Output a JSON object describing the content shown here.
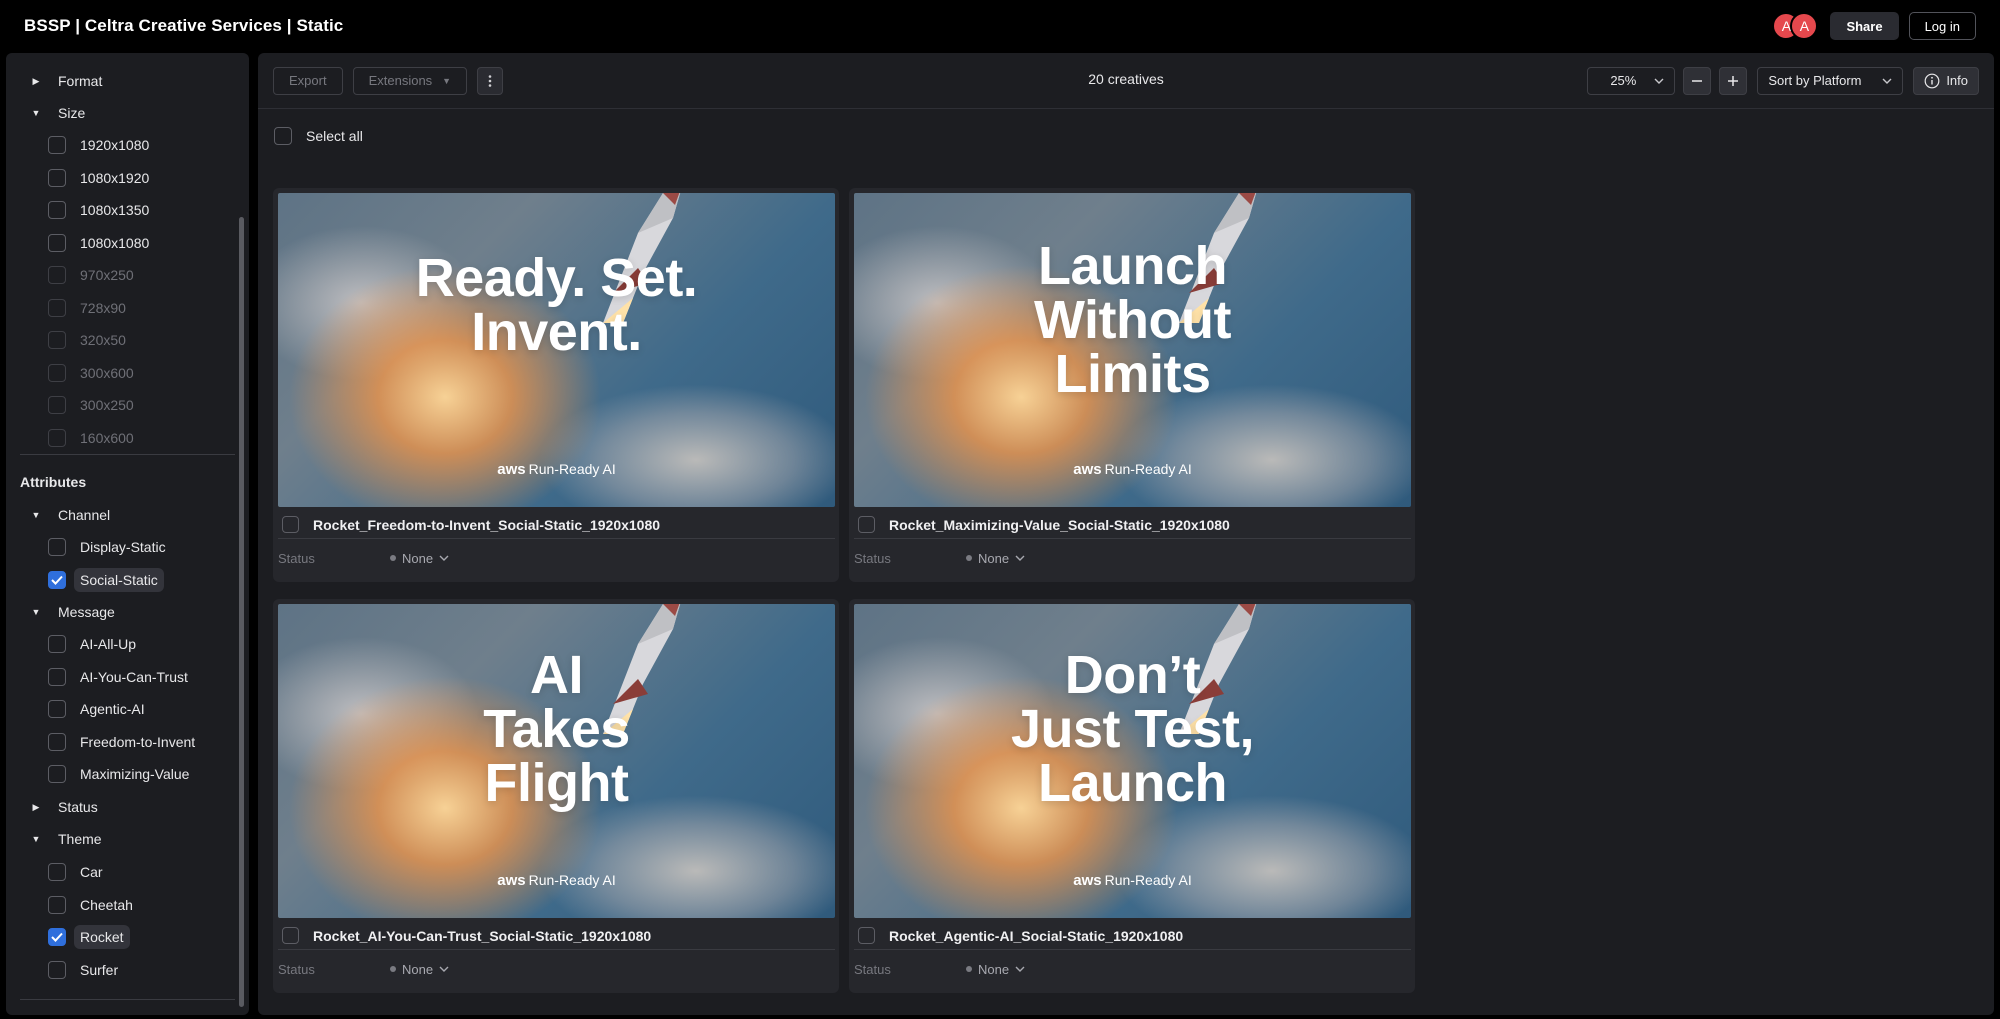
{
  "app_title": "BSSP | Celtra Creative Services | Static",
  "header": {
    "avatars": [
      "A",
      "A"
    ],
    "share_label": "Share",
    "login_label": "Log in",
    "avatar_color": "#e5484d"
  },
  "sidebar": {
    "format_label": "Format",
    "size_label": "Size",
    "sizes": [
      {
        "label": "1920x1080",
        "checked": false,
        "disabled": false
      },
      {
        "label": "1080x1920",
        "checked": false,
        "disabled": false
      },
      {
        "label": "1080x1350",
        "checked": false,
        "disabled": false
      },
      {
        "label": "1080x1080",
        "checked": false,
        "disabled": false
      },
      {
        "label": "970x250",
        "checked": false,
        "disabled": true
      },
      {
        "label": "728x90",
        "checked": false,
        "disabled": true
      },
      {
        "label": "320x50",
        "checked": false,
        "disabled": true
      },
      {
        "label": "300x600",
        "checked": false,
        "disabled": true
      },
      {
        "label": "300x250",
        "checked": false,
        "disabled": true
      },
      {
        "label": "160x600",
        "checked": false,
        "disabled": true
      }
    ],
    "attributes_label": "Attributes",
    "channel_label": "Channel",
    "channels": [
      {
        "label": "Display-Static",
        "checked": false
      },
      {
        "label": "Social-Static",
        "checked": true
      }
    ],
    "message_label": "Message",
    "messages": [
      {
        "label": "AI-All-Up",
        "checked": false
      },
      {
        "label": "AI-You-Can-Trust",
        "checked": false
      },
      {
        "label": "Agentic-AI",
        "checked": false
      },
      {
        "label": "Freedom-to-Invent",
        "checked": false
      },
      {
        "label": "Maximizing-Value",
        "checked": false
      }
    ],
    "status_label": "Status",
    "theme_label": "Theme",
    "themes": [
      {
        "label": "Car",
        "checked": false
      },
      {
        "label": "Cheetah",
        "checked": false
      },
      {
        "label": "Rocket",
        "checked": true
      },
      {
        "label": "Surfer",
        "checked": false
      }
    ]
  },
  "toolbar": {
    "export_label": "Export",
    "extensions_label": "Extensions",
    "count_label": "20 creatives",
    "zoom_value": "25%",
    "sort_label": "Sort by Platform",
    "info_label": "Info"
  },
  "select_all_label": "Select all",
  "creatives": [
    {
      "headline": [
        "Ready. Set.",
        "Invent."
      ],
      "brand_logo": "aws",
      "brand_text": "Run-Ready AI",
      "name": "Rocket_Freedom-to-Invent_Social-Static_1920x1080",
      "status_label": "Status",
      "status_value": "None"
    },
    {
      "headline": [
        "Launch",
        "Without",
        "Limits"
      ],
      "brand_logo": "aws",
      "brand_text": "Run-Ready AI",
      "name": "Rocket_Maximizing-Value_Social-Static_1920x1080",
      "status_label": "Status",
      "status_value": "None"
    },
    {
      "headline": [
        "AI",
        "Takes",
        "Flight"
      ],
      "brand_logo": "aws",
      "brand_text": "Run-Ready AI",
      "name": "Rocket_AI-You-Can-Trust_Social-Static_1920x1080",
      "status_label": "Status",
      "status_value": "None"
    },
    {
      "headline": [
        "Don’t",
        "Just Test,",
        "Launch"
      ],
      "brand_logo": "aws",
      "brand_text": "Run-Ready AI",
      "name": "Rocket_Agentic-AI_Social-Static_1920x1080",
      "status_label": "Status",
      "status_value": "None"
    }
  ]
}
